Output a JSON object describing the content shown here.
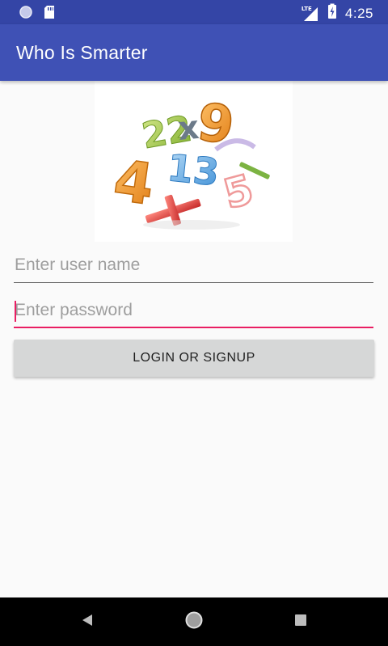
{
  "status_bar": {
    "time": "4:25",
    "network_label": "LTE",
    "icons": [
      "circle-notification-icon",
      "sd-card-icon",
      "lte-signal-icon",
      "battery-charging-icon"
    ]
  },
  "app_bar": {
    "title": "Who Is Smarter"
  },
  "login_form": {
    "username": {
      "value": "",
      "placeholder": "Enter user name"
    },
    "password": {
      "value": "",
      "placeholder": "Enter password"
    },
    "submit_label": "LOGIN OR SIGNUP"
  },
  "logo": {
    "glyphs": [
      "22",
      "x",
      "9",
      "4",
      "13",
      "5",
      "+"
    ]
  },
  "nav_bar": {
    "icons": [
      "back-icon",
      "home-icon",
      "recents-icon"
    ]
  },
  "colors": {
    "status_bar": "#3445a6",
    "app_bar": "#3f51b5",
    "accent": "#e91e63",
    "background": "#fafafa",
    "button": "#d6d7d7"
  }
}
